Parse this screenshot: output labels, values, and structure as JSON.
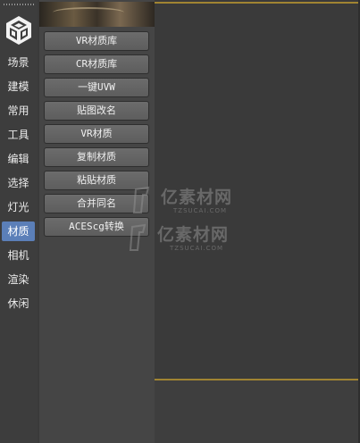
{
  "sidebar": {
    "logo_icon": "cube-logo-icon",
    "categories": [
      {
        "label": "场景",
        "active": false
      },
      {
        "label": "建模",
        "active": false
      },
      {
        "label": "常用",
        "active": false
      },
      {
        "label": "工具",
        "active": false
      },
      {
        "label": "编辑",
        "active": false
      },
      {
        "label": "选择",
        "active": false
      },
      {
        "label": "灯光",
        "active": false
      },
      {
        "label": "材质",
        "active": true
      },
      {
        "label": "相机",
        "active": false
      },
      {
        "label": "渲染",
        "active": false
      },
      {
        "label": "休闲",
        "active": false
      }
    ]
  },
  "panel": {
    "buttons": [
      "VR材质库",
      "CR材质库",
      "一键UVW",
      "贴图改名",
      "VR材质",
      "复制材质",
      "粘贴材质",
      "合并同名",
      "ACEScg转换"
    ]
  },
  "watermark": {
    "text": "亿素材网",
    "subtext": "TZSUCAI.COM"
  },
  "colors": {
    "active_tab": "#5b7fb8",
    "accent_line": "#a08432",
    "panel_bg": "#454545",
    "viewport_bg": "#3a3a3a"
  }
}
